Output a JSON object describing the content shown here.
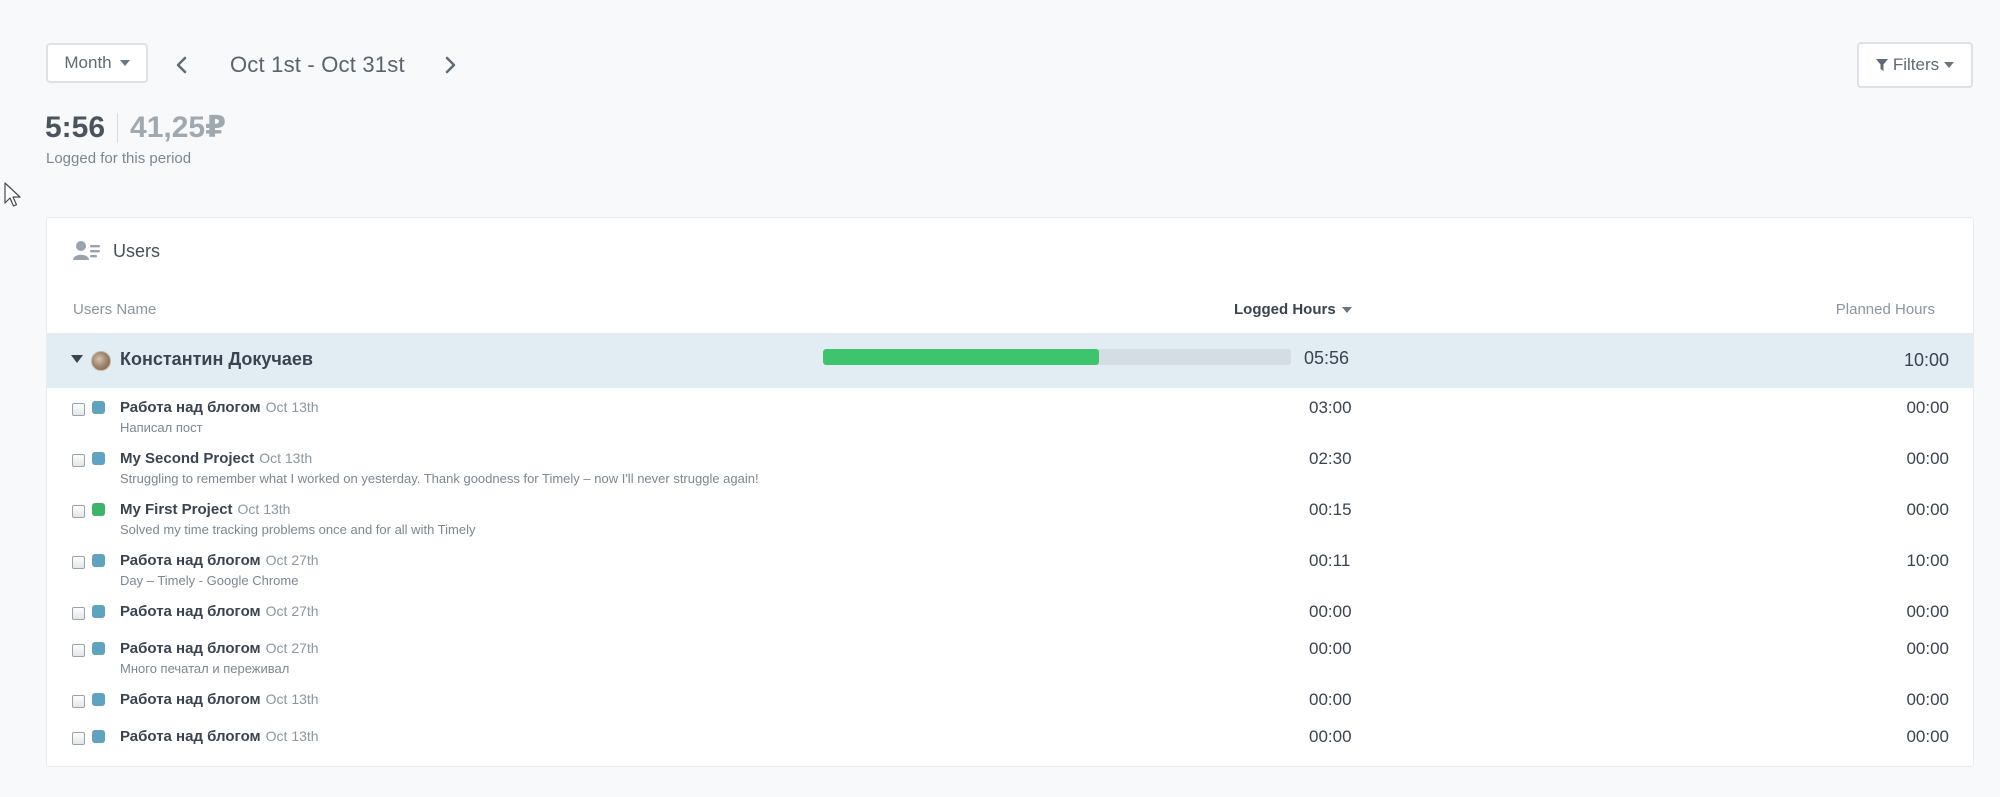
{
  "header": {
    "period_label": "Month",
    "date_range": "Oct 1st - Oct 31st",
    "filters_label": "Filters"
  },
  "summary": {
    "total_time": "5:56",
    "total_money": "41,25₽",
    "label": "Logged for this period"
  },
  "panel": {
    "title": "Users",
    "columns": {
      "users": "Users Name",
      "logged": "Logged Hours",
      "planned": "Planned Hours"
    },
    "user": {
      "name": "Константин Докучаев",
      "logged": "05:56",
      "planned": "10:00",
      "progress_fraction": 0.59
    },
    "entries": [
      {
        "project": "Работа над блогом",
        "date": "Oct 13th",
        "note": "Написал пост",
        "logged": "03:00",
        "planned": "00:00",
        "color": "#5fa3c0"
      },
      {
        "project": "My Second Project",
        "date": "Oct 13th",
        "note": "Struggling to remember what I worked on yesterday. Thank goodness for Timely – now I'll never struggle again!",
        "logged": "02:30",
        "planned": "00:00",
        "color": "#5fa3c0"
      },
      {
        "project": "My First Project",
        "date": "Oct 13th",
        "note": "Solved my time tracking problems once and for all with Timely",
        "logged": "00:15",
        "planned": "00:00",
        "color": "#3fb36a"
      },
      {
        "project": "Работа над блогом",
        "date": "Oct 27th",
        "note": "Day – Timely - Google Chrome",
        "logged": "00:11",
        "planned": "10:00",
        "color": "#5fa3c0"
      },
      {
        "project": "Работа над блогом",
        "date": "Oct 27th",
        "note": "",
        "logged": "00:00",
        "planned": "00:00",
        "color": "#5fa3c0"
      },
      {
        "project": "Работа над блогом",
        "date": "Oct 27th",
        "note": "Много печатал и переживал",
        "logged": "00:00",
        "planned": "00:00",
        "color": "#5fa3c0"
      },
      {
        "project": "Работа над блогом",
        "date": "Oct 13th",
        "note": "",
        "logged": "00:00",
        "planned": "00:00",
        "color": "#5fa3c0"
      },
      {
        "project": "Работа над блогом",
        "date": "Oct 13th",
        "note": "",
        "logged": "00:00",
        "planned": "00:00",
        "color": "#5fa3c0"
      }
    ]
  }
}
